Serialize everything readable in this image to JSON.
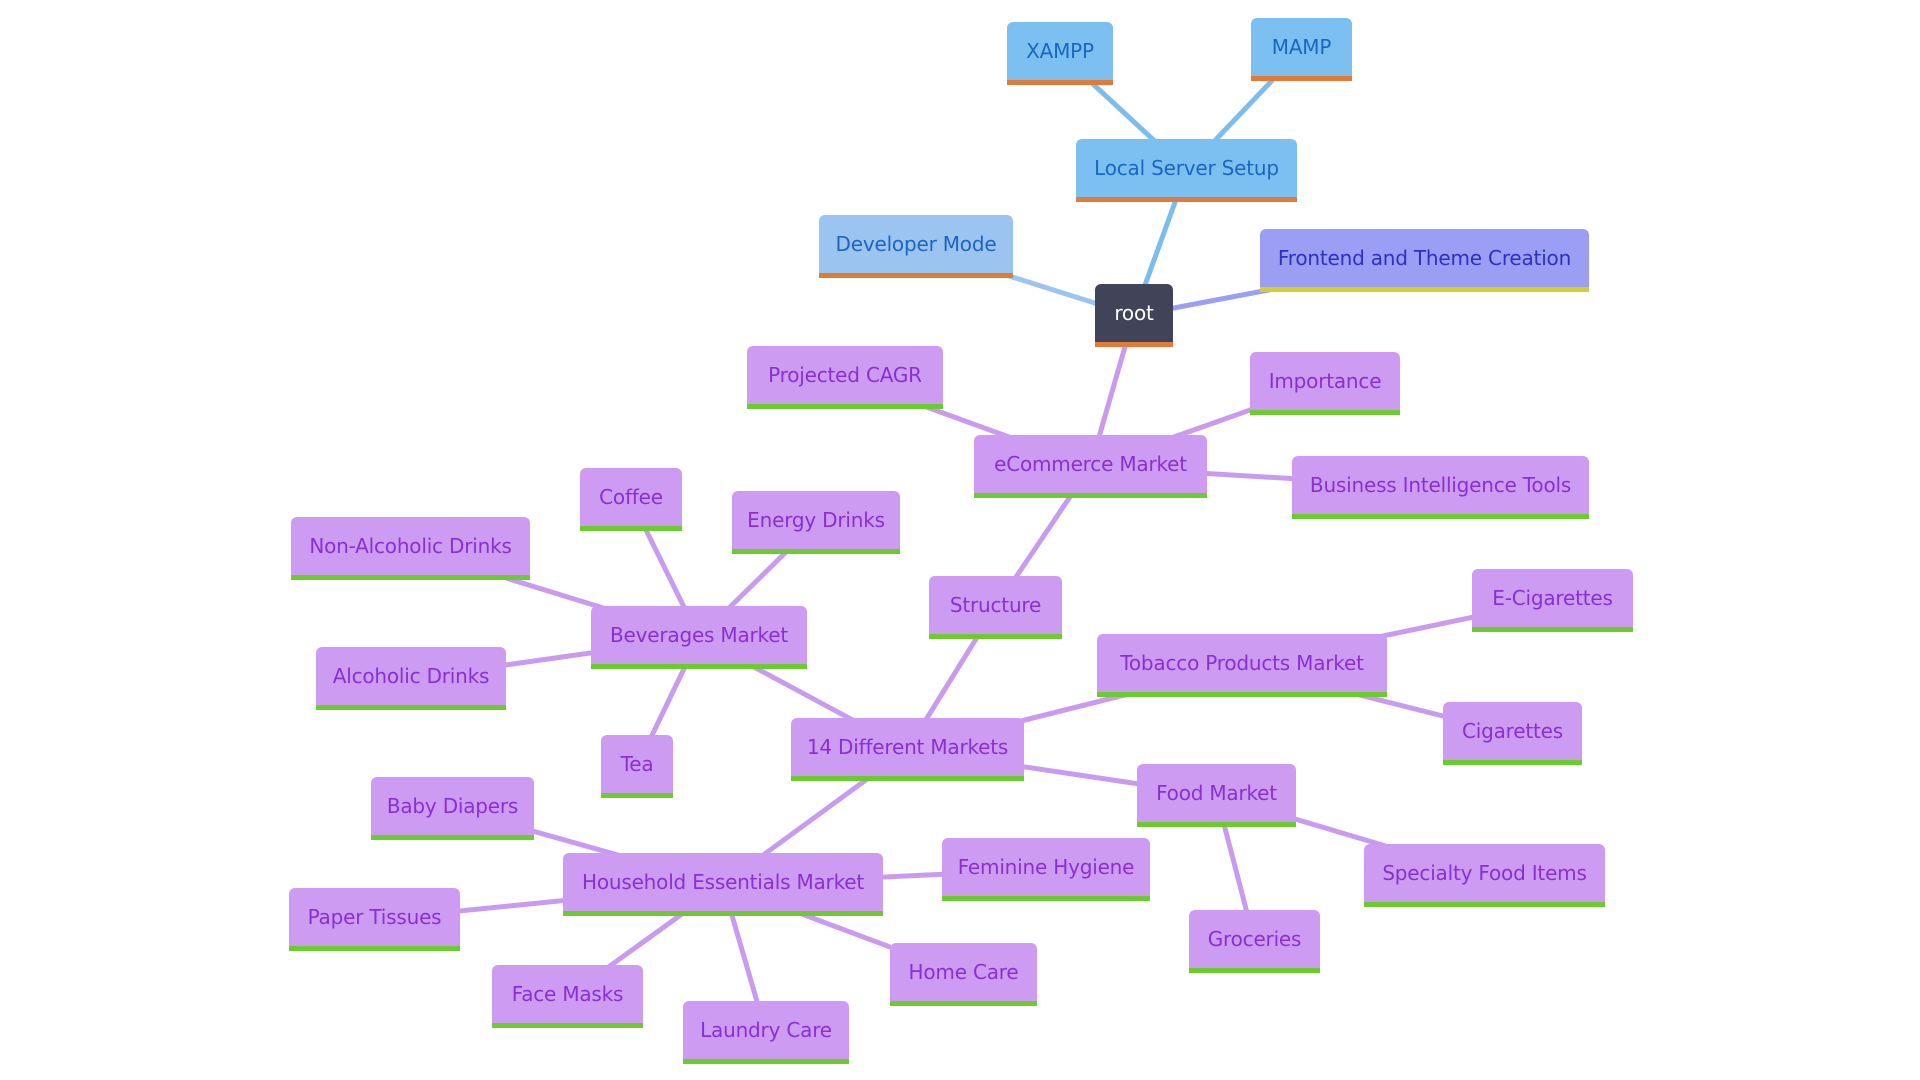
{
  "diagram": {
    "type": "mindmap",
    "colors": {
      "root": "#414459",
      "branch_local_server": "#7cc0f1",
      "branch_developer_mode": "#9bc4f1",
      "branch_frontend": "#9b9ef2",
      "branch_ecommerce": "#cd9cf2"
    },
    "nodes": {
      "root": "root",
      "local_server_setup": "Local Server Setup",
      "xampp": "XAMPP",
      "mamp": "MAMP",
      "developer_mode": "Developer Mode",
      "frontend_theme": "Frontend and Theme Creation",
      "ecommerce_market": "eCommerce Market",
      "projected_cagr": "Projected CAGR",
      "importance": "Importance",
      "bi_tools": "Business Intelligence Tools",
      "structure": "Structure",
      "different_markets": "14 Different Markets",
      "beverages_market": "Beverages Market",
      "coffee": "Coffee",
      "energy_drinks": "Energy Drinks",
      "non_alcoholic": "Non-Alcoholic Drinks",
      "alcoholic": "Alcoholic Drinks",
      "tea": "Tea",
      "tobacco_market": "Tobacco Products Market",
      "e_cigarettes": "E-Cigarettes",
      "cigarettes": "Cigarettes",
      "food_market": "Food Market",
      "specialty_food": "Specialty Food Items",
      "groceries": "Groceries",
      "household_market": "Household Essentials Market",
      "baby_diapers": "Baby Diapers",
      "paper_tissues": "Paper Tissues",
      "face_masks": "Face Masks",
      "laundry_care": "Laundry Care",
      "home_care": "Home Care",
      "feminine_hygiene": "Feminine Hygiene"
    },
    "edges": [
      [
        "root",
        "local_server_setup"
      ],
      [
        "local_server_setup",
        "xampp"
      ],
      [
        "local_server_setup",
        "mamp"
      ],
      [
        "root",
        "developer_mode"
      ],
      [
        "root",
        "frontend_theme"
      ],
      [
        "root",
        "ecommerce_market"
      ],
      [
        "ecommerce_market",
        "projected_cagr"
      ],
      [
        "ecommerce_market",
        "importance"
      ],
      [
        "ecommerce_market",
        "bi_tools"
      ],
      [
        "ecommerce_market",
        "structure"
      ],
      [
        "structure",
        "different_markets"
      ],
      [
        "different_markets",
        "beverages_market"
      ],
      [
        "beverages_market",
        "coffee"
      ],
      [
        "beverages_market",
        "energy_drinks"
      ],
      [
        "beverages_market",
        "non_alcoholic"
      ],
      [
        "beverages_market",
        "alcoholic"
      ],
      [
        "beverages_market",
        "tea"
      ],
      [
        "different_markets",
        "tobacco_market"
      ],
      [
        "tobacco_market",
        "e_cigarettes"
      ],
      [
        "tobacco_market",
        "cigarettes"
      ],
      [
        "different_markets",
        "food_market"
      ],
      [
        "food_market",
        "specialty_food"
      ],
      [
        "food_market",
        "groceries"
      ],
      [
        "different_markets",
        "household_market"
      ],
      [
        "household_market",
        "baby_diapers"
      ],
      [
        "household_market",
        "paper_tissues"
      ],
      [
        "household_market",
        "face_masks"
      ],
      [
        "household_market",
        "laundry_care"
      ],
      [
        "household_market",
        "home_care"
      ],
      [
        "household_market",
        "feminine_hygiene"
      ]
    ]
  }
}
